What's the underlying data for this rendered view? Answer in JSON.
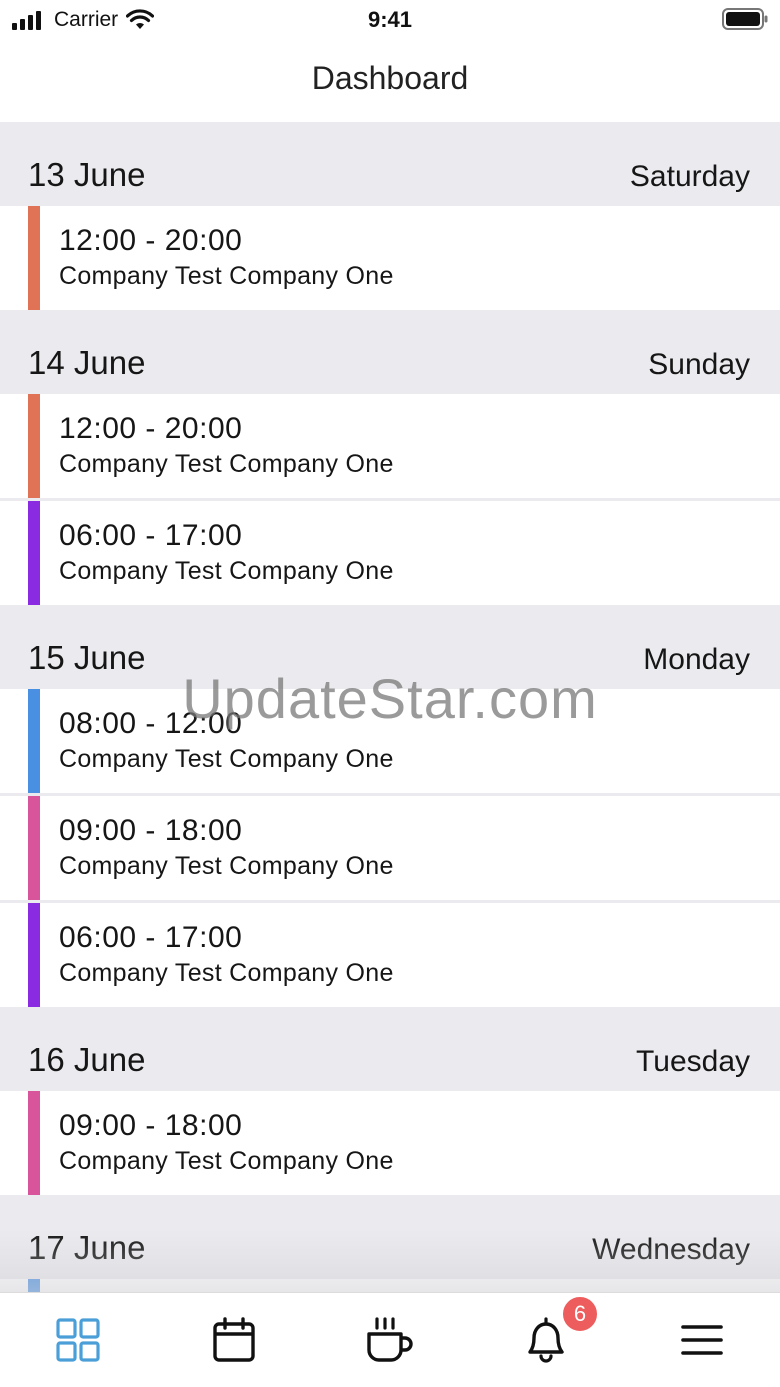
{
  "status_bar": {
    "carrier": "Carrier",
    "time": "9:41"
  },
  "nav": {
    "title": "Dashboard"
  },
  "days": [
    {
      "date": "13 June",
      "weekday": "Saturday",
      "shifts": [
        {
          "time": "12:00 - 20:00",
          "company": "Company Test Company One",
          "color": "#e07355"
        }
      ]
    },
    {
      "date": "14 June",
      "weekday": "Sunday",
      "shifts": [
        {
          "time": "12:00 - 20:00",
          "company": "Company Test Company One",
          "color": "#e07355"
        },
        {
          "time": "06:00 - 17:00",
          "company": "Company Test Company One",
          "color": "#8a2be2"
        }
      ]
    },
    {
      "date": "15 June",
      "weekday": "Monday",
      "shifts": [
        {
          "time": "08:00 - 12:00",
          "company": "Company Test Company One",
          "color": "#4a90e2"
        },
        {
          "time": "09:00 - 18:00",
          "company": "Company Test Company One",
          "color": "#d9559b"
        },
        {
          "time": "06:00 - 17:00",
          "company": "Company Test Company One",
          "color": "#8a2be2"
        }
      ]
    },
    {
      "date": "16 June",
      "weekday": "Tuesday",
      "shifts": [
        {
          "time": "09:00 - 18:00",
          "company": "Company Test Company One",
          "color": "#d9559b"
        }
      ]
    },
    {
      "date": "17 June",
      "weekday": "Wednesday",
      "shifts": [
        {
          "time": "",
          "company": "",
          "color": "#4a90e2"
        }
      ]
    }
  ],
  "watermark": "UpdateStar.com",
  "tabbar": {
    "items": [
      {
        "name": "dashboard",
        "icon": "grid-icon",
        "active": true
      },
      {
        "name": "calendar",
        "icon": "calendar-icon",
        "active": false
      },
      {
        "name": "break",
        "icon": "coffee-cup-icon",
        "active": false
      },
      {
        "name": "notifications",
        "icon": "bell-icon",
        "active": false,
        "badge": "6"
      },
      {
        "name": "menu",
        "icon": "hamburger-menu-icon",
        "active": false
      }
    ]
  },
  "colors": {
    "accent": "#4a9fd8",
    "badge": "#ee5d5d",
    "background": "#ebebef"
  }
}
